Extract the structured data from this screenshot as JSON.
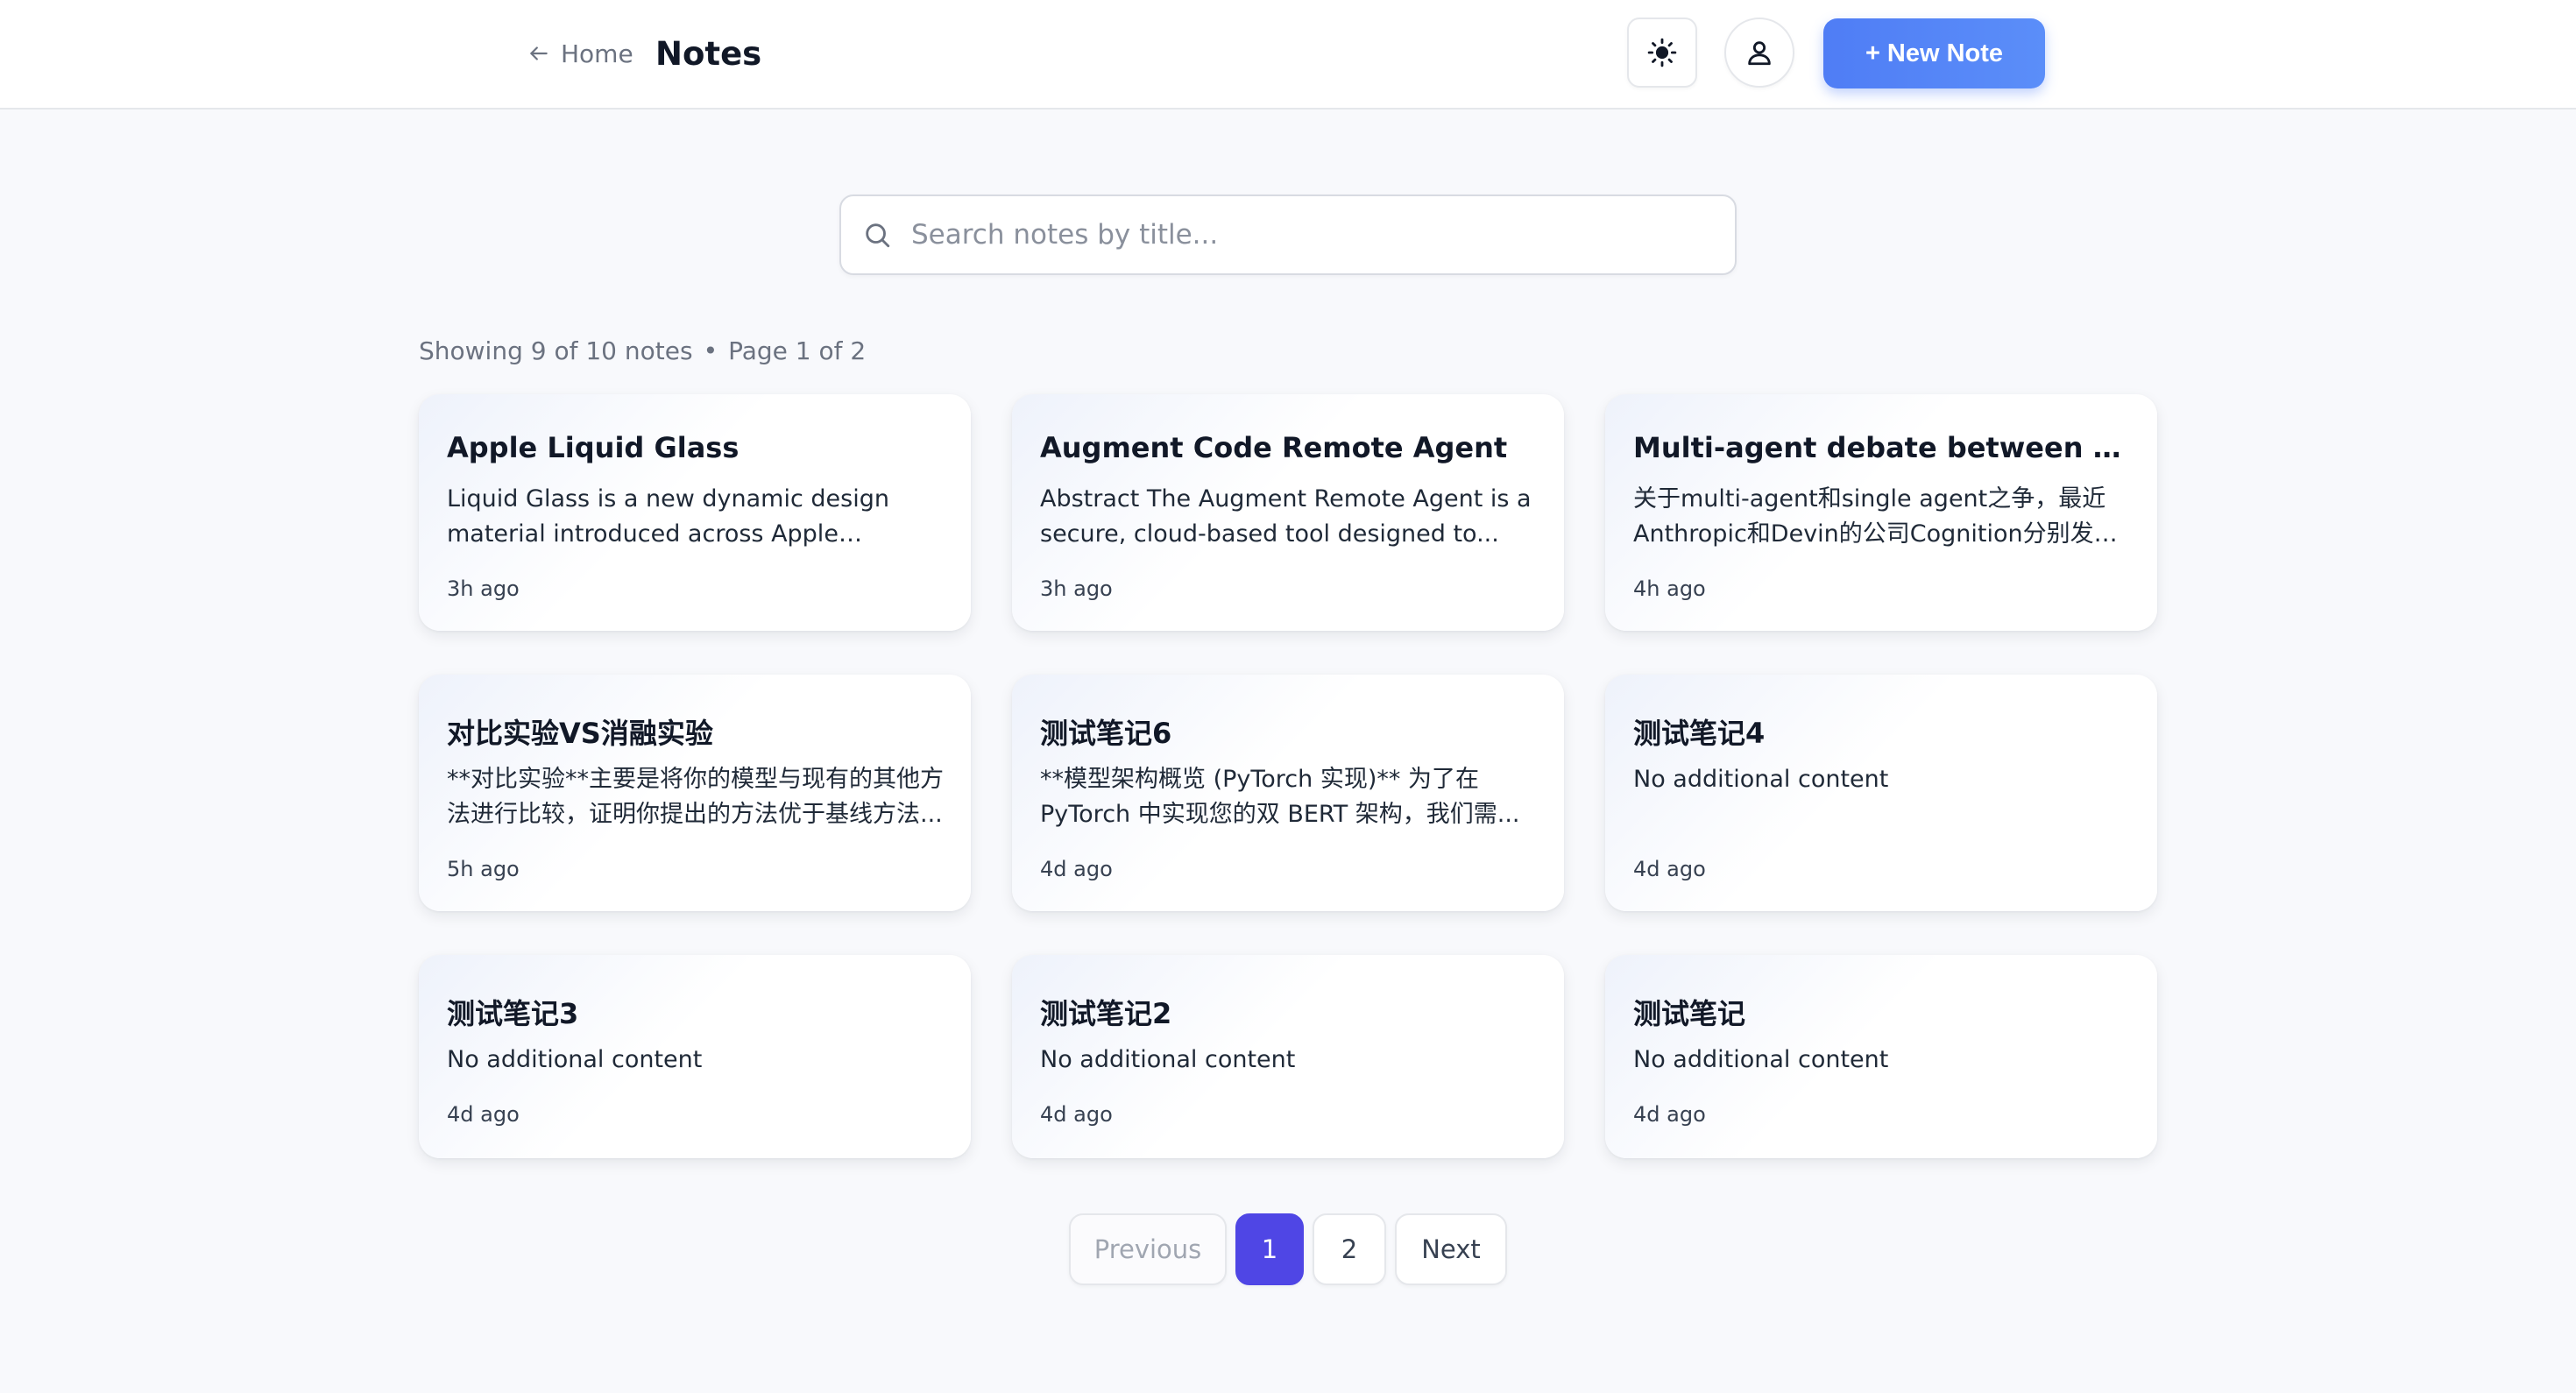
{
  "header": {
    "back_label": "Home",
    "title": "Notes",
    "new_note_label": "+ New Note"
  },
  "search": {
    "placeholder": "Search notes by title...",
    "value": ""
  },
  "summary": {
    "showing": "Showing 9 of 10 notes",
    "separator": "•",
    "page": "Page 1 of 2"
  },
  "notes": [
    {
      "title": "Apple Liquid Glass",
      "excerpt": "Liquid Glass is a new dynamic design material introduced across Apple platforms...",
      "time": "3h ago"
    },
    {
      "title": "Augment Code Remote Agent",
      "excerpt": "Abstract The Augment Remote Agent is a secure, cloud-based tool designed to...",
      "time": "3h ago"
    },
    {
      "title": "Multi-agent debate between Antro...",
      "excerpt": "关于multi-agent和single agent之争，最近Anthropic和Devin的公司Cognition分别发表...",
      "time": "4h ago"
    },
    {
      "title": "对比实验VS消融实验",
      "excerpt": "**对比实验**主要是将你的模型与现有的其他方法进行比较，证明你提出的方法优于基线方法...",
      "time": "5h ago"
    },
    {
      "title": "测试笔记6",
      "excerpt": "**模型架构概览 (PyTorch 实现)** 为了在 PyTorch 中实现您的双 BERT 架构，我们需...",
      "time": "4d ago"
    },
    {
      "title": "测试笔记4",
      "excerpt": "No additional content",
      "time": "4d ago"
    },
    {
      "title": "测试笔记3",
      "excerpt": "No additional content",
      "time": "4d ago"
    },
    {
      "title": "测试笔记2",
      "excerpt": "No additional content",
      "time": "4d ago"
    },
    {
      "title": "测试笔记",
      "excerpt": "No additional content",
      "time": "4d ago"
    }
  ],
  "pagination": {
    "previous_label": "Previous",
    "pages": [
      "1",
      "2"
    ],
    "current_page": "1",
    "next_label": "Next"
  },
  "colors": {
    "accent": "#4f46e5",
    "primary_button": "#5183f7",
    "background": "#f8f9fc"
  },
  "icons": {
    "back": "arrow-left-icon",
    "theme": "sun-icon",
    "profile": "user-icon",
    "search": "search-icon"
  }
}
